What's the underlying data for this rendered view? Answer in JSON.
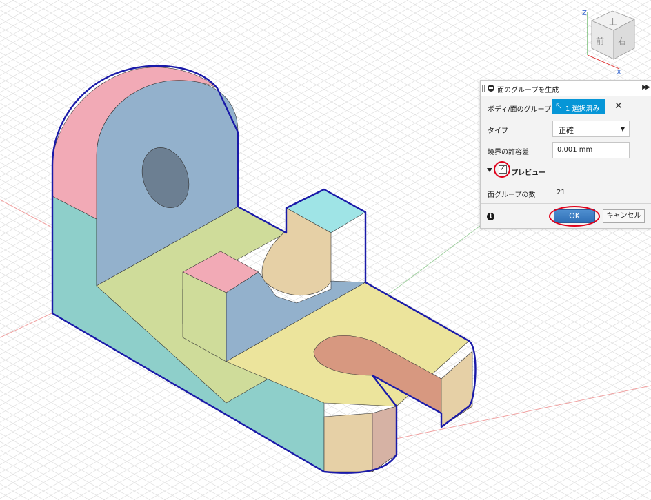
{
  "dialog": {
    "title": "面のグループを生成",
    "body_group_label": "ボディ/面のグループ",
    "selected_label": "1 選択済み",
    "type_label": "タイプ",
    "type_value": "正確",
    "boundary_tolerance_label": "境界の許容差",
    "boundary_tolerance_value": "0.001 mm",
    "preview_label": "プレビュー",
    "preview_checked": true,
    "face_group_count_label": "面グループの数",
    "face_group_count_value": "21",
    "ok_label": "OK",
    "cancel_label": "キャンセル",
    "selection_color": "#0696d7",
    "highlight_color": "#e0001a"
  },
  "viewcube": {
    "axes": [
      "Z",
      "X"
    ],
    "faces": [
      "上",
      "前",
      "右"
    ]
  },
  "model": {
    "outline_color": "#1a1aa8",
    "face_colors": {
      "teal": "#8ecfca",
      "blue": "#93b1cc",
      "pink": "#f2aab6",
      "green_yellow": "#cfdc9a",
      "yellow": "#ece49c",
      "cyan": "#9fe4e6",
      "tan": "#e6d0a6",
      "salmon": "#d79880",
      "rose": "#d6b2a4"
    }
  }
}
